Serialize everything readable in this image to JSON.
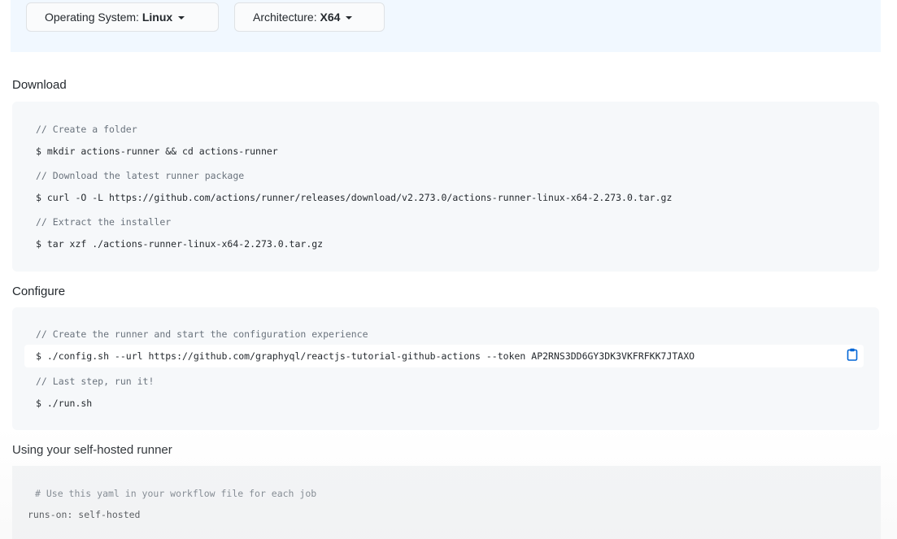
{
  "selectors": {
    "os": {
      "label": "Operating System: ",
      "value": "Linux"
    },
    "arch": {
      "label": "Architecture: ",
      "value": "X64"
    }
  },
  "download": {
    "heading": "Download",
    "lines": [
      {
        "type": "comment",
        "text": "// Create a folder"
      },
      {
        "type": "command",
        "text": "$ mkdir actions-runner && cd actions-runner"
      },
      {
        "type": "comment",
        "text": "// Download the latest runner package"
      },
      {
        "type": "command",
        "text": "$ curl -O -L https://github.com/actions/runner/releases/download/v2.273.0/actions-runner-linux-x64-2.273.0.tar.gz"
      },
      {
        "type": "comment",
        "text": "// Extract the installer"
      },
      {
        "type": "command",
        "text": "$ tar xzf ./actions-runner-linux-x64-2.273.0.tar.gz"
      }
    ]
  },
  "configure": {
    "heading": "Configure",
    "lines": [
      {
        "type": "comment",
        "text": "// Create the runner and start the configuration experience"
      },
      {
        "type": "command",
        "text": "$ ./config.sh --url https://github.com/graphyql/reactjs-tutorial-github-actions --token AP2RNS3DD6GY3DK3VKFRFKK7JTAXO"
      },
      {
        "type": "comment",
        "text": "// Last step, run it!"
      },
      {
        "type": "command",
        "text": "$ ./run.sh"
      }
    ],
    "copy_icon": "clipboard-icon"
  },
  "using": {
    "heading": "Using your self-hosted runner",
    "comment": "# Use this yaml in your workflow file for each job",
    "yaml": "runs-on: self-hosted"
  }
}
